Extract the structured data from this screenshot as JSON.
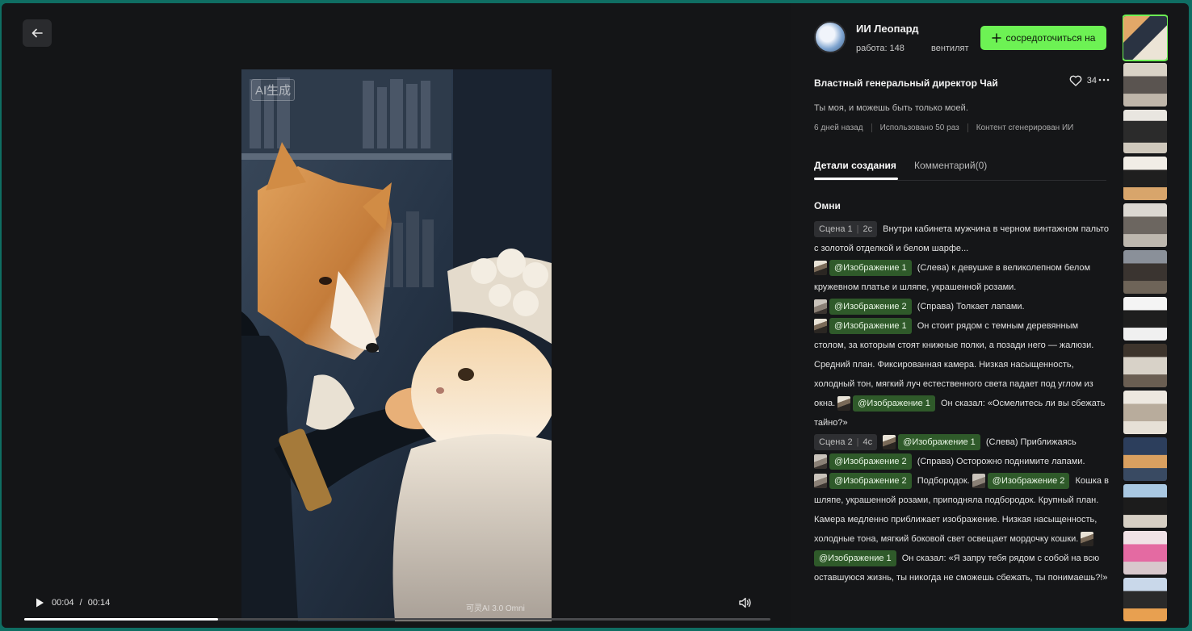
{
  "player": {
    "ai_badge": "AI生成",
    "watermark": "可灵AI 3.0 Omni",
    "current_time": "00:04",
    "separator": "/",
    "duration": "00:14",
    "progress_fraction": 0.26
  },
  "author": {
    "name": "ИИ Леопард",
    "works_label": "работа: 148",
    "fans_label": "вентилят",
    "follow_label": "сосредоточиться на"
  },
  "work": {
    "title": "Властный генеральный директор Чай",
    "likes": "34",
    "description": "Ты моя, и можешь быть только моей.",
    "meta": [
      "6 дней назад",
      "Использовано 50 раз",
      "Контент сгенерирован ИИ"
    ]
  },
  "tabs": [
    {
      "label": "Детали создания",
      "active": true
    },
    {
      "label": "Комментарий(0)",
      "active": false
    }
  ],
  "model": "Омни",
  "prompt": {
    "scene1_tag": "Сцена 1",
    "scene1_dur": "2с",
    "t1": "Внутри кабинета мужчина в черном винтажном пальто с золотой отделкой и белом шарфе...",
    "m1": "@Изображение 1",
    "t2": "(Слева) к девушке в великолепном белом кружевном платье и шляпе, украшенной розами.",
    "m2": "@Изображение 2",
    "t3": "(Справа) Толкает лапами.",
    "m3": "@Изображение 1",
    "t4": "Он стоит рядом с темным деревянным столом, за которым стоят книжные полки, а позади него — жалюзи. Средний план. Фиксированная камера. Низкая насыщенность, холодный тон, мягкий луч естественного света падает под углом из окна.",
    "m4": "@Изображение 1",
    "t5": "Он сказал: «Осмелитесь ли вы сбежать тайно?»",
    "scene2_tag": "Сцена 2",
    "scene2_dur": "4с",
    "m5": "@Изображение 1",
    "t6": "(Слева) Приближаясь",
    "m6": "@Изображение 2",
    "t7": "(Справа) Осторожно поднимите лапами.",
    "m7": "@Изображение 2",
    "t8": "Подбородок.",
    "m8": "@Изображение 2",
    "t9": "Кошка в шляпе, украшенной розами, приподняла подбородок. Крупный план. Камера медленно приближает изображение. Низкая насыщенность, холодные тона, мягкий боковой свет освещает мордочку кошки.",
    "m9": "@Изображение 1",
    "t10": "Он сказал: «Я запру тебя рядом с собой на всю оставшуюся жизнь, ты никогда не сможешь сбежать, ты понимаешь?!»"
  },
  "icons": {
    "back": "arrow-left-icon",
    "play": "play-icon",
    "volume": "volume-icon",
    "heart": "heart-icon",
    "more": "more-icon",
    "plus": "plus-icon"
  },
  "colors": {
    "accent": "#6df254",
    "mention_bg": "#2f5a2a"
  }
}
